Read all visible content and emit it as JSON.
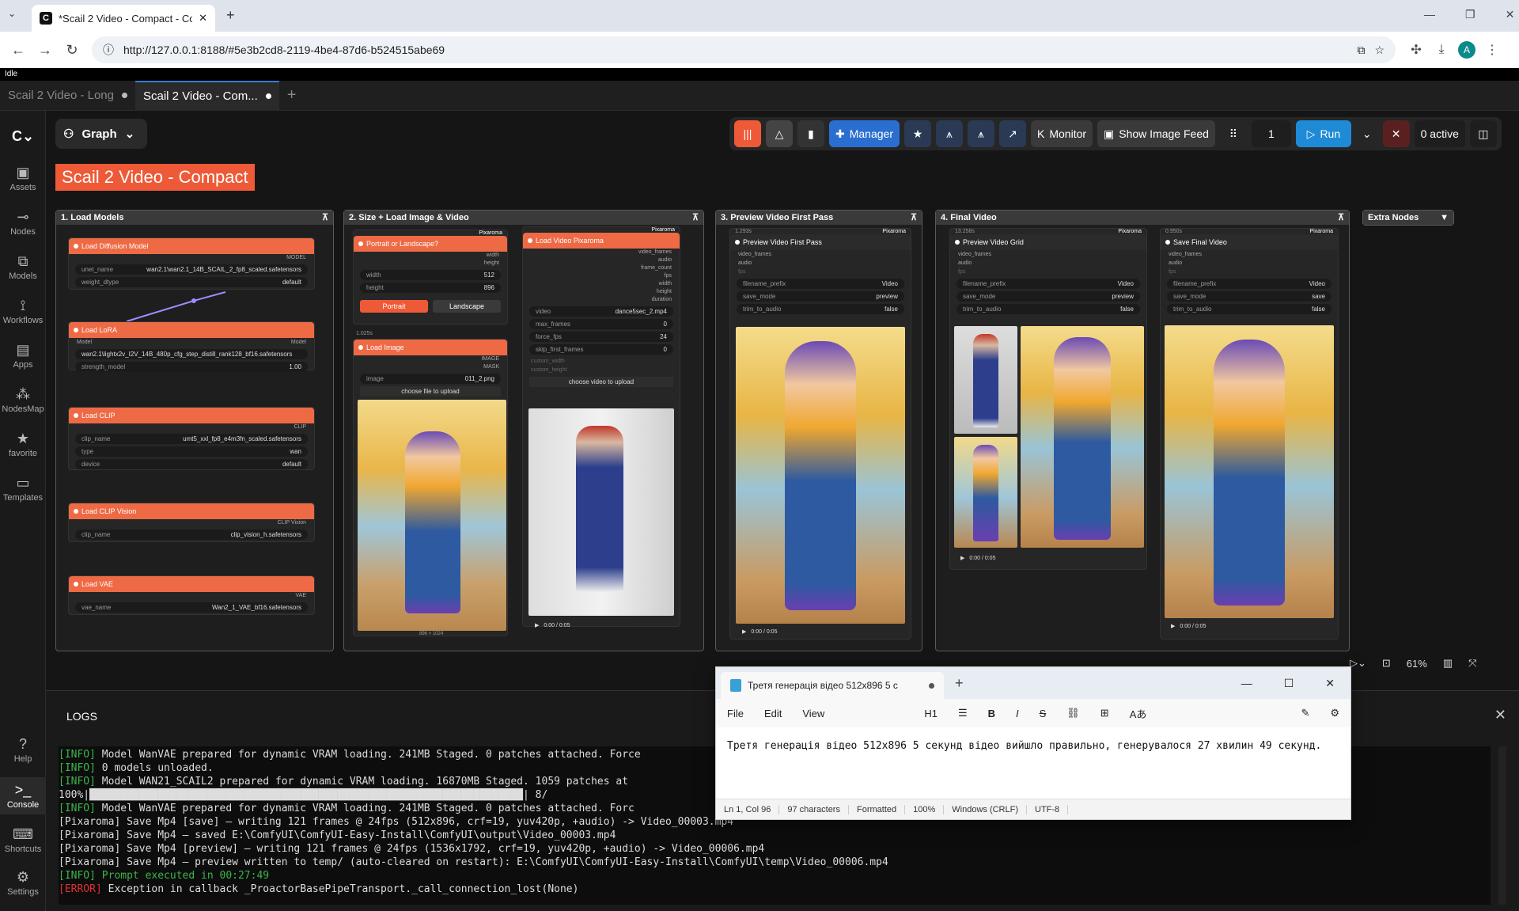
{
  "browser": {
    "tab_title": "*Scail 2 Video - Compact - Com",
    "url": "http://127.0.0.1:8188/#5e3b2cd8-2119-4be4-87d6-b524515abe69",
    "avatar": "A"
  },
  "status": "Idle",
  "tabs": [
    {
      "label": "Scail 2 Video - Long"
    },
    {
      "label": "Scail 2 Video - Com..."
    }
  ],
  "sidebar": [
    {
      "label": "Assets"
    },
    {
      "label": "Nodes"
    },
    {
      "label": "Models"
    },
    {
      "label": "Workflows"
    },
    {
      "label": "Apps"
    },
    {
      "label": "NodesMap"
    },
    {
      "label": "favorite"
    },
    {
      "label": "Templates"
    },
    {
      "label": "Help"
    },
    {
      "label": "Console"
    },
    {
      "label": "Shortcuts"
    },
    {
      "label": "Settings"
    }
  ],
  "graph_label": "Graph",
  "toolbar": {
    "manager": "Manager",
    "monitor": "Monitor",
    "show_feed": "Show Image Feed",
    "batch": "1",
    "run": "Run",
    "active": "0 active",
    "zoom": "61%"
  },
  "workflow_title": "Scail 2 Video - Compact",
  "groups": {
    "g1": "1. Load Models",
    "g2": "2. Size + Load Image & Video",
    "g3": "3. Preview Video First Pass",
    "g4": "4. Final Video",
    "g5": "Extra Nodes"
  },
  "nodes": {
    "diffusion": {
      "title": "Load Diffusion Model",
      "out": "MODEL",
      "unet_name": "unet_name",
      "unet_val": "wan2.1\\wan2.1_14B_SCAIL_2_fp8_scaled.safetensors",
      "wd": "weight_dtype",
      "wd_val": "default"
    },
    "lora": {
      "title": "Load LoRA",
      "in": "Model",
      "out": "Model",
      "lora_val": "wan2.1\\lightx2v_I2V_14B_480p_cfg_step_distill_rank128_bf16.safetensors",
      "sm": "strength_model",
      "sm_val": "1.00"
    },
    "clip": {
      "title": "Load CLIP",
      "out": "CLIP",
      "cn": "clip_name",
      "cn_val": "umt5_xxl_fp8_e4m3fn_scaled.safetensors",
      "type": "type",
      "type_val": "wan",
      "dev": "device",
      "dev_val": "default"
    },
    "clipvision": {
      "title": "Load CLIP Vision",
      "out": "CLIP Vision",
      "cn": "clip_name",
      "cn_val": "clip_vision_h.safetensors"
    },
    "vae": {
      "title": "Load VAE",
      "out": "VAE",
      "vn": "vae_name",
      "vn_val": "Wan2_1_VAE_bf16.safetensors"
    },
    "portrait": {
      "title": "Portrait or Landscape?",
      "badge": "Pixaroma",
      "width": "width",
      "height": "height",
      "w_val": "512",
      "h_val": "896",
      "btn1": "Portrait",
      "btn2": "Landscape"
    },
    "loadimage": {
      "title": "Load Image",
      "time": "1.025s",
      "o1": "IMAGE",
      "o2": "MASK",
      "img": "image",
      "img_val": "011_2.png",
      "upload": "choose file to upload",
      "dims": "896 × 1024"
    },
    "loadvideo": {
      "title": "Load Video Pixaroma",
      "badge": "Pixaroma",
      "outs": [
        "video_frames",
        "audio",
        "frame_count",
        "fps",
        "width",
        "height",
        "duration"
      ],
      "video": "video",
      "video_val": "dance5sec_2.mp4",
      "mf": "max_frames",
      "mf_val": "0",
      "ff": "force_fps",
      "ff_val": "24",
      "sf": "skip_first_frames",
      "sf_val": "0",
      "cw": "custom_width",
      "ch": "custom_height",
      "upload": "choose video to upload",
      "time": "0:00 / 0:05"
    },
    "preview1": {
      "title": "Preview Video First Pass",
      "time_badge": "1.293s",
      "badge": "Pixaroma",
      "ins": [
        "video_frames",
        "audio",
        "fps"
      ],
      "fp": "filename_prefix",
      "fp_val": "Video",
      "sm": "save_mode",
      "sm_val": "preview",
      "ta": "trim_to_audio",
      "ta_val": "false",
      "time": "0:00 / 0:05"
    },
    "grid": {
      "title": "Preview Video Grid",
      "time_badge": "13.258s",
      "badge": "Pixaroma",
      "ins": [
        "video_frames",
        "audio",
        "fps"
      ],
      "fp": "filename_prefix",
      "fp_val": "Video",
      "sm": "save_mode",
      "sm_val": "preview",
      "ta": "trim_to_audio",
      "ta_val": "false",
      "time": "0:00 / 0:05"
    },
    "final": {
      "title": "Save Final Video",
      "time_badge": "0.950s",
      "badge": "Pixaroma",
      "ins": [
        "video_frames",
        "audio",
        "fps"
      ],
      "fp": "filename_prefix",
      "fp_val": "Video",
      "sm": "save_mode",
      "sm_val": "save",
      "ta": "trim_to_audio",
      "ta_val": "false",
      "time": "0:00 / 0:05"
    }
  },
  "logs": {
    "title": "LOGS",
    "lines": [
      {
        "t": "[INFO]",
        "m": " Model WanVAE prepared for dynamic VRAM loading. 241MB Staged. 0 patches attached. Force"
      },
      {
        "t": "[INFO]",
        "m": " 0 models unloaded."
      },
      {
        "t": "[INFO]",
        "m": " Model WAN21_SCAIL2 prepared for dynamic VRAM loading. 16870MB Staged. 1059 patches at"
      },
      {
        "t": "",
        "m": "100%|██████████████████████████████████████████████████████████████████████| 8/"
      },
      {
        "t": "[INFO]",
        "m": " Model WanVAE prepared for dynamic VRAM loading. 241MB Staged. 0 patches attached. Forc"
      },
      {
        "t": "",
        "m": "[Pixaroma] Save Mp4 [save] — writing 121 frames @ 24fps (512x896, crf=19, yuv420p, +audio) -> Video_00003.mp4"
      },
      {
        "t": "",
        "m": "[Pixaroma] Save Mp4 — saved E:\\ComfyUI\\ComfyUI-Easy-Install\\ComfyUI\\output\\Video_00003.mp4"
      },
      {
        "t": "",
        "m": "[Pixaroma] Save Mp4 [preview] — writing 121 frames @ 24fps (1536x1792, crf=19, yuv420p, +audio) -> Video_00006.mp4"
      },
      {
        "t": "",
        "m": "[Pixaroma] Save Mp4 — preview written to temp/ (auto-cleared on restart): E:\\ComfyUI\\ComfyUI-Easy-Install\\ComfyUI\\temp\\Video_00006.mp4"
      },
      {
        "t": "[INFO]",
        "m": " Prompt executed in 00:27:49"
      },
      {
        "t": "[ERROR]",
        "m": " Exception in callback _ProactorBasePipeTransport._call_connection_lost(None)"
      }
    ]
  },
  "notepad": {
    "tab": "Третя генерація відео 512x896 5 с",
    "menu": [
      "File",
      "Edit",
      "View"
    ],
    "heading": "H1",
    "text": "Третя генерація відео 512x896 5 секунд відео вийшло правильно, генерувалося 27 хвилин 49 секунд.",
    "status": [
      "Ln 1, Col 96",
      "97 characters",
      "Formatted",
      "100%",
      "Windows (CRLF)",
      "UTF-8"
    ]
  },
  "colors": {
    "accent": "#ee6a45",
    "run": "#1f8ad6",
    "manager": "#2a6fd0"
  }
}
